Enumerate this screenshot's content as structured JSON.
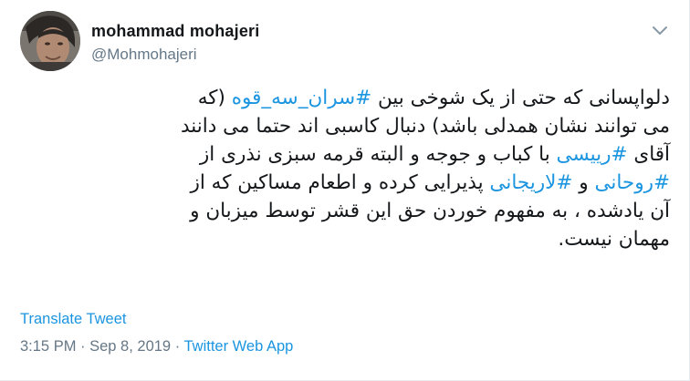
{
  "user": {
    "display_name": "mohammad mohajeri",
    "handle": "@Mohmohajeri",
    "avatar_icon": "profile-photo"
  },
  "menu": {
    "icon": "chevron-down-icon"
  },
  "tweet": {
    "line1": {
      "a": "دلواپسانی که حتی از یک شوخی بین ",
      "tag": "#سران_سه_قوه",
      "b": " (که"
    },
    "line2": "می توانند نشان همدلی باشد) دنبال کاسبی اند حتما می دانند",
    "line3": {
      "a": "آقای ",
      "tag": "#رییسی",
      "b": " با کباب و جوجه و البته قرمه سبزی نذری از"
    },
    "line4": {
      "tag1": "#روحانی",
      "a": " و ",
      "tag2": "#لاریجانی",
      "b": " پذیرایی کرده و اطعام مساکین که از"
    },
    "line5": "آن یادشده ، به مفهوم خوردن حق این قشر توسط میزبان و",
    "line6": "مهمان نیست."
  },
  "translate_label": "Translate Tweet",
  "meta": {
    "timestamp": "3:15 PM · Sep 8, 2019 · ",
    "source": "Twitter Web App"
  },
  "colors": {
    "link": "#1b95e0",
    "secondary": "#657786",
    "text": "#14171a"
  }
}
